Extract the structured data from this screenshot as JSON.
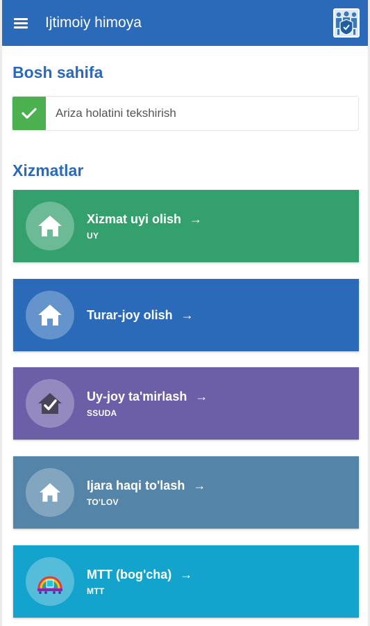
{
  "appbar": {
    "title": "Ijtimoiy himoya",
    "menu_icon": "hamburger-menu-icon",
    "logo_icon": "people-shield-logo"
  },
  "page": {
    "title": "Bosh sahifa"
  },
  "status_check": {
    "label": "Ariza holatini tekshirish",
    "icon": "checkmark-icon",
    "color": "#4caf50"
  },
  "services": {
    "title": "Xizmatlar",
    "items": [
      {
        "label": "Xizmat uyi olish",
        "sub": "UY",
        "icon": "house-icon",
        "color": "#34a06e"
      },
      {
        "label": "Turar-joy olish",
        "sub": "",
        "icon": "house-icon",
        "color": "#2a6ab8"
      },
      {
        "label": "Uy-joy ta'mirlash",
        "sub": "SSUDA",
        "icon": "house-check-icon",
        "color": "#6d5ea8"
      },
      {
        "label": "Ijara haqi to'lash",
        "sub": "TO'LOV",
        "icon": "house-icon",
        "color": "#5484a8"
      },
      {
        "label": "MTT (bog'cha)",
        "sub": "MTT",
        "icon": "rainbow-kindergarten-icon",
        "color": "#14a3cc"
      }
    ],
    "arrow": "→"
  },
  "colors": {
    "appbar": "#2a6ab8",
    "heading": "#2a6ab8"
  }
}
